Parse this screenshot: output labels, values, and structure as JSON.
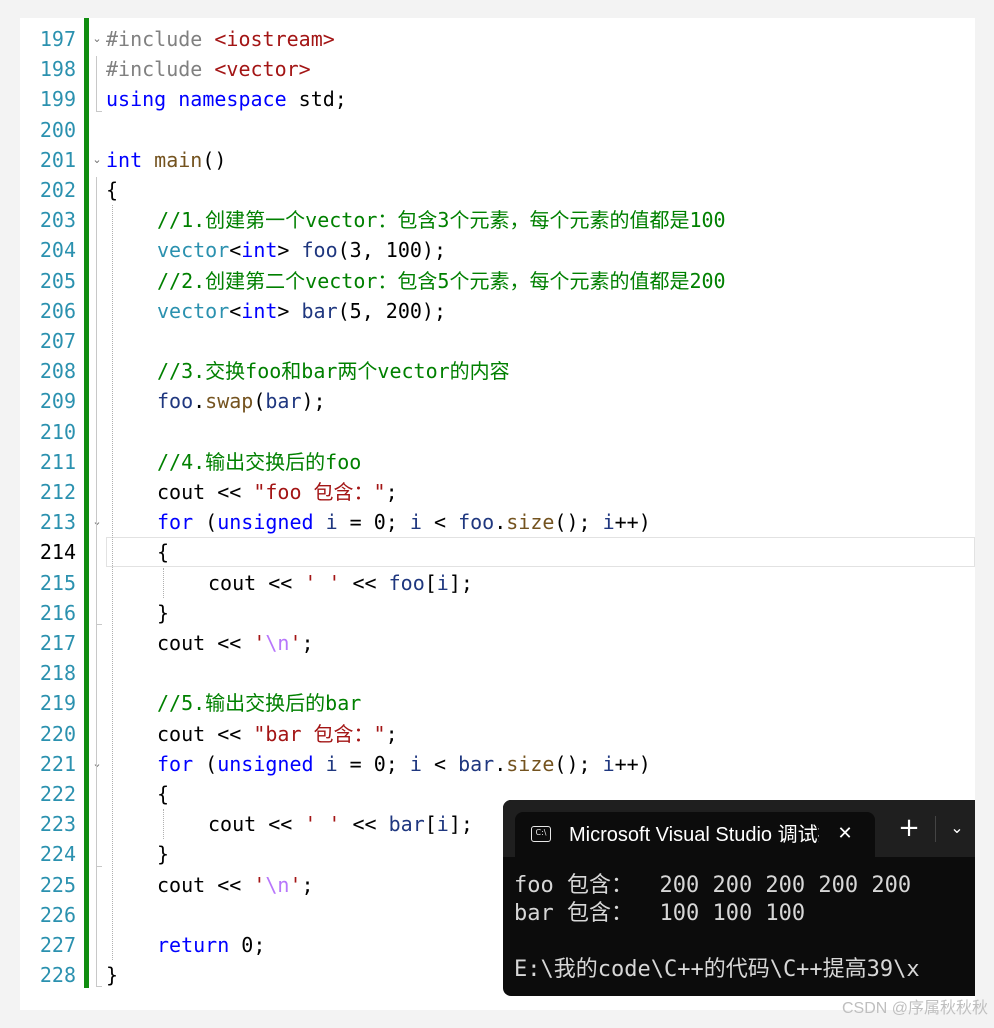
{
  "editor": {
    "current_line": 214,
    "lines": [
      {
        "n": 197,
        "indent": 0,
        "tokens": [
          [
            "pp",
            "#include "
          ],
          [
            "str",
            "<iostream>"
          ]
        ]
      },
      {
        "n": 198,
        "indent": 0,
        "tokens": [
          [
            "pp",
            "#include "
          ],
          [
            "str",
            "<vector>"
          ]
        ]
      },
      {
        "n": 199,
        "indent": 0,
        "tokens": [
          [
            "kw",
            "using"
          ],
          [
            "pun",
            " "
          ],
          [
            "kw",
            "namespace"
          ],
          [
            "pun",
            " std;"
          ]
        ]
      },
      {
        "n": 200,
        "indent": 0,
        "tokens": []
      },
      {
        "n": 201,
        "indent": 0,
        "tokens": [
          [
            "kw",
            "int"
          ],
          [
            "pun",
            " "
          ],
          [
            "fn",
            "main"
          ],
          [
            "pun",
            "()"
          ]
        ]
      },
      {
        "n": 202,
        "indent": 0,
        "tokens": [
          [
            "pun",
            "{"
          ]
        ]
      },
      {
        "n": 203,
        "indent": 1,
        "tokens": [
          [
            "cmt",
            "//1.创建第一个vector：包含3个元素，每个元素的值都是100"
          ]
        ]
      },
      {
        "n": 204,
        "indent": 1,
        "tokens": [
          [
            "typ",
            "vector"
          ],
          [
            "pun",
            "<"
          ],
          [
            "kw",
            "int"
          ],
          [
            "pun",
            "> "
          ],
          [
            "var",
            "foo"
          ],
          [
            "pun",
            "(3, 100);"
          ]
        ]
      },
      {
        "n": 205,
        "indent": 1,
        "tokens": [
          [
            "cmt",
            "//2.创建第二个vector：包含5个元素，每个元素的值都是200"
          ]
        ]
      },
      {
        "n": 206,
        "indent": 1,
        "tokens": [
          [
            "typ",
            "vector"
          ],
          [
            "pun",
            "<"
          ],
          [
            "kw",
            "int"
          ],
          [
            "pun",
            "> "
          ],
          [
            "var",
            "bar"
          ],
          [
            "pun",
            "(5, 200);"
          ]
        ]
      },
      {
        "n": 207,
        "indent": 1,
        "tokens": []
      },
      {
        "n": 208,
        "indent": 1,
        "tokens": [
          [
            "cmt",
            "//3.交换foo和bar两个vector的内容"
          ]
        ]
      },
      {
        "n": 209,
        "indent": 1,
        "tokens": [
          [
            "var",
            "foo"
          ],
          [
            "pun",
            "."
          ],
          [
            "fn",
            "swap"
          ],
          [
            "pun",
            "("
          ],
          [
            "var",
            "bar"
          ],
          [
            "pun",
            ");"
          ]
        ]
      },
      {
        "n": 210,
        "indent": 1,
        "tokens": []
      },
      {
        "n": 211,
        "indent": 1,
        "tokens": [
          [
            "cmt",
            "//4.输出交换后的foo"
          ]
        ]
      },
      {
        "n": 212,
        "indent": 1,
        "tokens": [
          [
            "pun",
            "cout << "
          ],
          [
            "str",
            "\"foo 包含：\""
          ],
          [
            "pun",
            ";"
          ]
        ]
      },
      {
        "n": 213,
        "indent": 1,
        "tokens": [
          [
            "kw",
            "for"
          ],
          [
            "pun",
            " ("
          ],
          [
            "kw",
            "unsigned"
          ],
          [
            "pun",
            " "
          ],
          [
            "var",
            "i"
          ],
          [
            "pun",
            " = 0; "
          ],
          [
            "var",
            "i"
          ],
          [
            "pun",
            " < "
          ],
          [
            "var",
            "foo"
          ],
          [
            "pun",
            "."
          ],
          [
            "fn",
            "size"
          ],
          [
            "pun",
            "(); "
          ],
          [
            "var",
            "i"
          ],
          [
            "pun",
            "++)"
          ]
        ]
      },
      {
        "n": 214,
        "indent": 1,
        "tokens": [
          [
            "pun",
            "{"
          ]
        ]
      },
      {
        "n": 215,
        "indent": 2,
        "tokens": [
          [
            "pun",
            "cout << "
          ],
          [
            "str",
            "' '"
          ],
          [
            "pun",
            " << "
          ],
          [
            "var",
            "foo"
          ],
          [
            "pun",
            "["
          ],
          [
            "var",
            "i"
          ],
          [
            "pun",
            "];"
          ]
        ]
      },
      {
        "n": 216,
        "indent": 1,
        "tokens": [
          [
            "pun",
            "}"
          ]
        ]
      },
      {
        "n": 217,
        "indent": 1,
        "tokens": [
          [
            "pun",
            "cout << "
          ],
          [
            "str",
            "'"
          ],
          [
            "esc",
            "\\n"
          ],
          [
            "str",
            "'"
          ],
          [
            "pun",
            ";"
          ]
        ]
      },
      {
        "n": 218,
        "indent": 1,
        "tokens": []
      },
      {
        "n": 219,
        "indent": 1,
        "tokens": [
          [
            "cmt",
            "//5.输出交换后的bar"
          ]
        ]
      },
      {
        "n": 220,
        "indent": 1,
        "tokens": [
          [
            "pun",
            "cout << "
          ],
          [
            "str",
            "\"bar 包含：\""
          ],
          [
            "pun",
            ";"
          ]
        ]
      },
      {
        "n": 221,
        "indent": 1,
        "tokens": [
          [
            "kw",
            "for"
          ],
          [
            "pun",
            " ("
          ],
          [
            "kw",
            "unsigned"
          ],
          [
            "pun",
            " "
          ],
          [
            "var",
            "i"
          ],
          [
            "pun",
            " = 0; "
          ],
          [
            "var",
            "i"
          ],
          [
            "pun",
            " < "
          ],
          [
            "var",
            "bar"
          ],
          [
            "pun",
            "."
          ],
          [
            "fn",
            "size"
          ],
          [
            "pun",
            "(); "
          ],
          [
            "var",
            "i"
          ],
          [
            "pun",
            "++)"
          ]
        ]
      },
      {
        "n": 222,
        "indent": 1,
        "tokens": [
          [
            "pun",
            "{"
          ]
        ]
      },
      {
        "n": 223,
        "indent": 2,
        "tokens": [
          [
            "pun",
            "cout << "
          ],
          [
            "str",
            "' '"
          ],
          [
            "pun",
            " << "
          ],
          [
            "var",
            "bar"
          ],
          [
            "pun",
            "["
          ],
          [
            "var",
            "i"
          ],
          [
            "pun",
            "];"
          ]
        ]
      },
      {
        "n": 224,
        "indent": 1,
        "tokens": [
          [
            "pun",
            "}"
          ]
        ]
      },
      {
        "n": 225,
        "indent": 1,
        "tokens": [
          [
            "pun",
            "cout << "
          ],
          [
            "str",
            "'"
          ],
          [
            "esc",
            "\\n"
          ],
          [
            "str",
            "'"
          ],
          [
            "pun",
            ";"
          ]
        ]
      },
      {
        "n": 226,
        "indent": 1,
        "tokens": []
      },
      {
        "n": 227,
        "indent": 1,
        "tokens": [
          [
            "kw",
            "return"
          ],
          [
            "pun",
            " 0;"
          ]
        ]
      },
      {
        "n": 228,
        "indent": 0,
        "tokens": [
          [
            "pun",
            "}"
          ]
        ]
      }
    ],
    "fold_lines": [
      197,
      201,
      213,
      221
    ]
  },
  "terminal": {
    "tab_title": "Microsoft Visual Studio 调试控制台",
    "tab_icon": "C:\\",
    "close_glyph": "✕",
    "new_tab_glyph": "+",
    "dropdown_glyph": "⌄",
    "output": [
      "foo 包含：  200 200 200 200 200",
      "bar 包含：  100 100 100",
      "",
      "E:\\我的code\\C++的代码\\C++提高39\\x"
    ]
  },
  "watermark": "CSDN @序属秋秋秋",
  "colors": {
    "keyword": "#0000ff",
    "comment": "#008000",
    "string": "#a31515",
    "type": "#2b91af",
    "variable": "#1f377f",
    "function": "#74531f",
    "change_bar": "#108d10",
    "terminal_bg": "#0c0c0c"
  }
}
